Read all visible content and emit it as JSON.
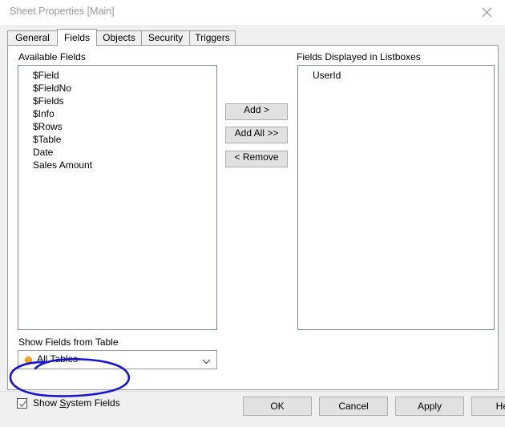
{
  "window": {
    "title": "Sheet Properties [Main]",
    "close_icon": "close-icon"
  },
  "tabs": [
    {
      "label": "General",
      "selected": false
    },
    {
      "label": "Fields",
      "selected": true
    },
    {
      "label": "Objects",
      "selected": false
    },
    {
      "label": "Security",
      "selected": false
    },
    {
      "label": "Triggers",
      "selected": false
    }
  ],
  "available_fields": {
    "label": "Available Fields",
    "items": [
      "$Field",
      "$FieldNo",
      "$Fields",
      "$Info",
      "$Rows",
      "$Table",
      "Date",
      "Sales Amount"
    ]
  },
  "transfer_buttons": [
    {
      "label": "Add >",
      "name": "add-button"
    },
    {
      "label": "Add All >>",
      "name": "add-all-button"
    },
    {
      "label": "< Remove",
      "name": "remove-button"
    }
  ],
  "displayed_fields": {
    "label": "Fields Displayed in Listboxes",
    "items": [
      "UserId"
    ]
  },
  "show_fields_from_table": {
    "label": "Show Fields from Table",
    "selected": "All Tables",
    "dot_color": "#f3a712",
    "arrow_icon": "chevron-down-icon"
  },
  "show_system_fields": {
    "label_prefix": "Show ",
    "label_accel": "S",
    "label_suffix": "ystem Fields",
    "label_full": "Show System Fields",
    "checked": true,
    "check_icon": "check-icon"
  },
  "footer_buttons": [
    {
      "label": "OK",
      "name": "ok-button"
    },
    {
      "label": "Cancel",
      "name": "cancel-button"
    },
    {
      "label": "Apply",
      "name": "apply-button"
    },
    {
      "label": "Help",
      "name": "help-button"
    }
  ],
  "annotation": {
    "name": "handdrawn-ellipse-annotation",
    "color": "#1414d2"
  }
}
